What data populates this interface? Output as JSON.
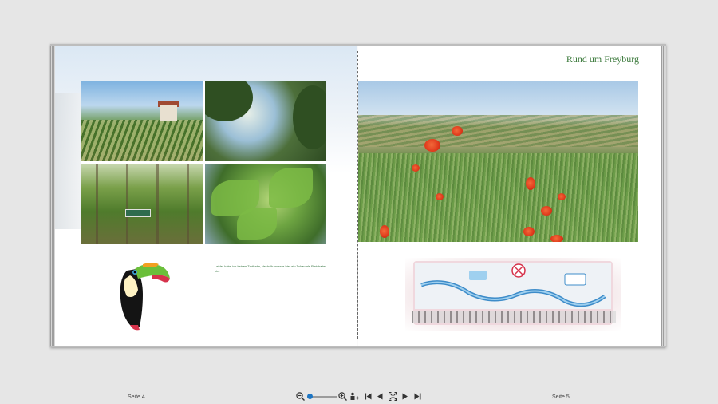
{
  "book": {
    "left_page": {
      "photos": [
        {
          "description_name": "vineyard-hill-photo"
        },
        {
          "description_name": "tree-landscape-photo"
        },
        {
          "description_name": "vineyard-rows-photo"
        },
        {
          "description_name": "vine-leaves-photo"
        }
      ],
      "placeholder_caption": "Leider habe ich keinen Truthahn, deshalb musste hier ein Tukan als Platzhalter hin."
    },
    "right_page": {
      "title": "Rund um Freyburg"
    }
  },
  "footer": {
    "left_page_label": "Seite 4",
    "right_page_label": "Seite 5"
  },
  "toolbar": {
    "zoom_level": 0.1,
    "icons": [
      "zoom-out-icon",
      "zoom-in-icon",
      "add-page-icon",
      "first-page-icon",
      "previous-page-icon",
      "fit-to-screen-icon",
      "next-page-icon",
      "last-page-icon"
    ]
  },
  "colors": {
    "title_green": "#3c7a3c",
    "caption_green": "#2f6f3a",
    "zoom_accent": "#1d76c4",
    "app_background": "#e6e6e6"
  }
}
